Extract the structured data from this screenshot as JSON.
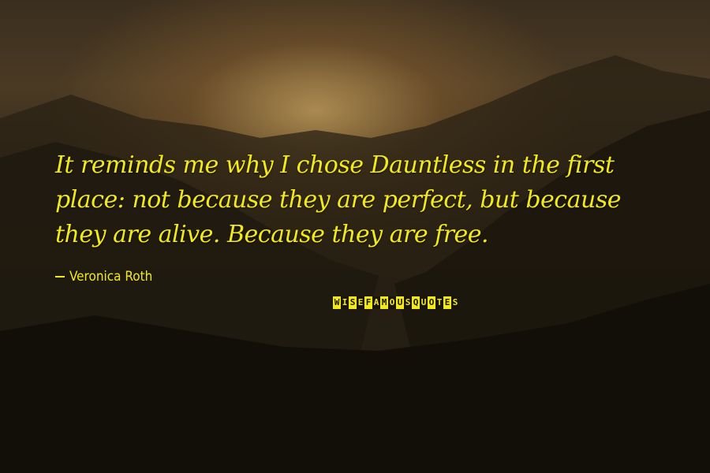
{
  "quote": {
    "text": "It reminds me why I chose Dauntless in the first place: not because they are perfect, but because they are alive. Because they are free.",
    "author": "Veronica Roth"
  },
  "brand": {
    "letters": [
      "W",
      "I",
      "S",
      "E",
      "F",
      "A",
      "M",
      "O",
      "U",
      "S",
      "Q",
      "U",
      "O",
      "T",
      "E",
      "S"
    ]
  },
  "colors": {
    "text": "#f2ea18",
    "brand_dark": "#1a1509"
  }
}
